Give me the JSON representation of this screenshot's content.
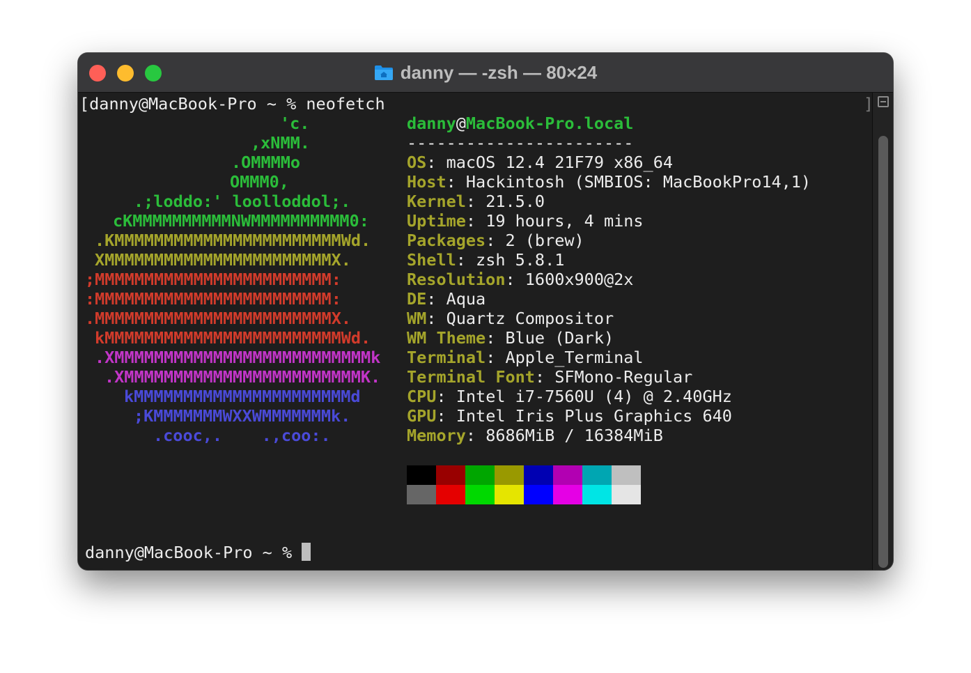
{
  "window": {
    "title": "danny — -zsh — 80×24",
    "icon": "home-folder-icon",
    "traffic_lights": {
      "close": "#ff5f57",
      "minimize": "#febc2e",
      "zoom": "#28c840"
    }
  },
  "terminal": {
    "command_line": "[danny@MacBook-Pro ~ % neofetch",
    "logo": [
      {
        "text": "'c.",
        "color": "green"
      },
      {
        "text": ",xNMM.",
        "color": "green"
      },
      {
        "text": ".OMMMMo",
        "color": "green"
      },
      {
        "text": "OMMM0,",
        "color": "green"
      },
      {
        "text": ".;loddo:' loolloddol;.",
        "color": "green"
      },
      {
        "text": "cKMMMMMMMMMMNWMMMMMMMMMM0:",
        "color": "green"
      },
      {
        "text": ".KMMMMMMMMMMMMMMMMMMMMMMMWd.",
        "color": "yellow"
      },
      {
        "text": "XMMMMMMMMMMMMMMMMMMMMMMMX.",
        "color": "yellow"
      },
      {
        "text": ";MMMMMMMMMMMMMMMMMMMMMMMM:",
        "color": "red"
      },
      {
        "text": ":MMMMMMMMMMMMMMMMMMMMMMMM:",
        "color": "red"
      },
      {
        "text": ".MMMMMMMMMMMMMMMMMMMMMMMMX.",
        "color": "red"
      },
      {
        "text": "kMMMMMMMMMMMMMMMMMMMMMMMMWd.",
        "color": "red"
      },
      {
        "text": ".XMMMMMMMMMMMMMMMMMMMMMMMMMMk",
        "color": "magenta"
      },
      {
        "text": ".XMMMMMMMMMMMMMMMMMMMMMMMMK.",
        "color": "magenta"
      },
      {
        "text": "kMMMMMMMMMMMMMMMMMMMMMMd",
        "color": "blue"
      },
      {
        "text": ";KMMMMMMMWXXWMMMMMMMk.",
        "color": "blue"
      },
      {
        "text": ".cooc,.    .,coo:.",
        "color": "blue"
      }
    ],
    "header": {
      "user": "danny",
      "at": "@",
      "host": "MacBook-Pro.local",
      "divider": "-----------------------"
    },
    "info": [
      {
        "label": "OS",
        "value": "macOS 12.4 21F79 x86_64"
      },
      {
        "label": "Host",
        "value": "Hackintosh (SMBIOS: MacBookPro14,1)"
      },
      {
        "label": "Kernel",
        "value": "21.5.0"
      },
      {
        "label": "Uptime",
        "value": "19 hours, 4 mins"
      },
      {
        "label": "Packages",
        "value": "2 (brew)"
      },
      {
        "label": "Shell",
        "value": "zsh 5.8.1"
      },
      {
        "label": "Resolution",
        "value": "1600x900@2x"
      },
      {
        "label": "DE",
        "value": "Aqua"
      },
      {
        "label": "WM",
        "value": "Quartz Compositor"
      },
      {
        "label": "WM Theme",
        "value": "Blue (Dark)"
      },
      {
        "label": "Terminal",
        "value": "Apple_Terminal"
      },
      {
        "label": "Terminal Font",
        "value": "SFMono-Regular"
      },
      {
        "label": "CPU",
        "value": "Intel i7-7560U (4) @ 2.40GHz"
      },
      {
        "label": "GPU",
        "value": "Intel Iris Plus Graphics 640"
      },
      {
        "label": "Memory",
        "value": "8686MiB / 16384MiB"
      }
    ],
    "palette": {
      "normal": [
        "#000000",
        "#990000",
        "#00a600",
        "#999900",
        "#0000b2",
        "#b200b2",
        "#00a6b2",
        "#bfbfbf"
      ],
      "bright": [
        "#666666",
        "#e50000",
        "#00d900",
        "#e5e500",
        "#0000ff",
        "#e500e5",
        "#00e5e5",
        "#e5e5e5"
      ]
    },
    "prompt": "danny@MacBook-Pro ~ % ",
    "logo_colors": {
      "green": "#2bbd3a",
      "yellow": "#a5a52b",
      "red": "#d23b2b",
      "magenta": "#c235c8",
      "blue": "#4a4ad8"
    }
  }
}
